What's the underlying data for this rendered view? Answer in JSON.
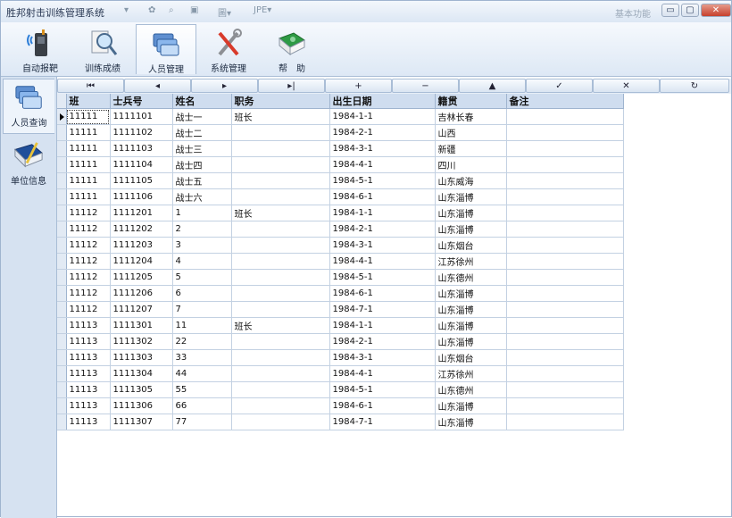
{
  "app": {
    "title": "胜邦射击训练管理系统",
    "right_info": "基本功能"
  },
  "window_controls": {
    "minimize": "▭",
    "restore": "▢",
    "close": "✕"
  },
  "quick_access": [
    {
      "name": "qa-dropdown",
      "glyph": "▾"
    },
    {
      "name": "qa-tool-1",
      "glyph": "✿"
    },
    {
      "name": "qa-tool-2",
      "glyph": "⌕"
    },
    {
      "name": "qa-tool-3",
      "glyph": "▣"
    },
    {
      "name": "qa-tool-4",
      "glyph": "圖▾"
    },
    {
      "name": "qa-tool-5",
      "glyph": "JPE▾"
    }
  ],
  "ribbon_tabs": [
    {
      "label": "自动报靶",
      "icon": "target-device-icon",
      "active": false
    },
    {
      "label": "训练成绩",
      "icon": "magnifier-document-icon",
      "active": false
    },
    {
      "label": "人员管理",
      "icon": "people-cards-icon",
      "active": true
    },
    {
      "label": "系统管理",
      "icon": "tools-icon",
      "active": false
    },
    {
      "label": "帮　助",
      "icon": "help-book-icon",
      "active": false
    }
  ],
  "sidebar_items": [
    {
      "label": "人员查询",
      "icon": "people-search-icon",
      "active": true
    },
    {
      "label": "单位信息",
      "icon": "unit-book-icon",
      "active": false
    }
  ],
  "navigator_buttons": [
    {
      "name": "nav-first-button",
      "glyph": "⏮"
    },
    {
      "name": "nav-prev-button",
      "glyph": "◂"
    },
    {
      "name": "nav-next-button",
      "glyph": "▸"
    },
    {
      "name": "nav-last-button",
      "glyph": "▸|"
    },
    {
      "name": "nav-insert-button",
      "glyph": "+"
    },
    {
      "name": "nav-delete-button",
      "glyph": "−"
    },
    {
      "name": "nav-edit-button",
      "glyph": "▲"
    },
    {
      "name": "nav-post-button",
      "glyph": "✓"
    },
    {
      "name": "nav-cancel-button",
      "glyph": "✕"
    },
    {
      "name": "nav-refresh-button",
      "glyph": "↻"
    }
  ],
  "grid": {
    "columns": [
      "班",
      "士兵号",
      "姓名",
      "职务",
      "出生日期",
      "籍贯",
      "备注"
    ],
    "rows": [
      [
        "11111",
        "1111101",
        "战士一",
        "班长",
        "1984-1-1",
        "吉林长春",
        ""
      ],
      [
        "11111",
        "1111102",
        "战士二",
        "",
        "1984-2-1",
        "山西",
        ""
      ],
      [
        "11111",
        "1111103",
        "战士三",
        "",
        "1984-3-1",
        "新疆",
        ""
      ],
      [
        "11111",
        "1111104",
        "战士四",
        "",
        "1984-4-1",
        "四川",
        ""
      ],
      [
        "11111",
        "1111105",
        "战士五",
        "",
        "1984-5-1",
        "山东威海",
        ""
      ],
      [
        "11111",
        "1111106",
        "战士六",
        "",
        "1984-6-1",
        "山东淄博",
        ""
      ],
      [
        "11112",
        "1111201",
        "1",
        "班长",
        "1984-1-1",
        "山东淄博",
        ""
      ],
      [
        "11112",
        "1111202",
        "2",
        "",
        "1984-2-1",
        "山东淄博",
        ""
      ],
      [
        "11112",
        "1111203",
        "3",
        "",
        "1984-3-1",
        "山东烟台",
        ""
      ],
      [
        "11112",
        "1111204",
        "4",
        "",
        "1984-4-1",
        "江苏徐州",
        ""
      ],
      [
        "11112",
        "1111205",
        "5",
        "",
        "1984-5-1",
        "山东德州",
        ""
      ],
      [
        "11112",
        "1111206",
        "6",
        "",
        "1984-6-1",
        "山东淄博",
        ""
      ],
      [
        "11112",
        "1111207",
        "7",
        "",
        "1984-7-1",
        "山东淄博",
        ""
      ],
      [
        "11113",
        "1111301",
        "11",
        "班长",
        "1984-1-1",
        "山东淄博",
        ""
      ],
      [
        "11113",
        "1111302",
        "22",
        "",
        "1984-2-1",
        "山东淄博",
        ""
      ],
      [
        "11113",
        "1111303",
        "33",
        "",
        "1984-3-1",
        "山东烟台",
        ""
      ],
      [
        "11113",
        "1111304",
        "44",
        "",
        "1984-4-1",
        "江苏徐州",
        ""
      ],
      [
        "11113",
        "1111305",
        "55",
        "",
        "1984-5-1",
        "山东德州",
        ""
      ],
      [
        "11113",
        "1111306",
        "66",
        "",
        "1984-6-1",
        "山东淄博",
        ""
      ],
      [
        "11113",
        "1111307",
        "77",
        "",
        "1984-7-1",
        "山东淄博",
        ""
      ]
    ],
    "selected_row": 0
  },
  "colors": {
    "accent": "#cfddef",
    "ribbon": "#dde8f5",
    "sidebar": "#d6e2f1"
  }
}
